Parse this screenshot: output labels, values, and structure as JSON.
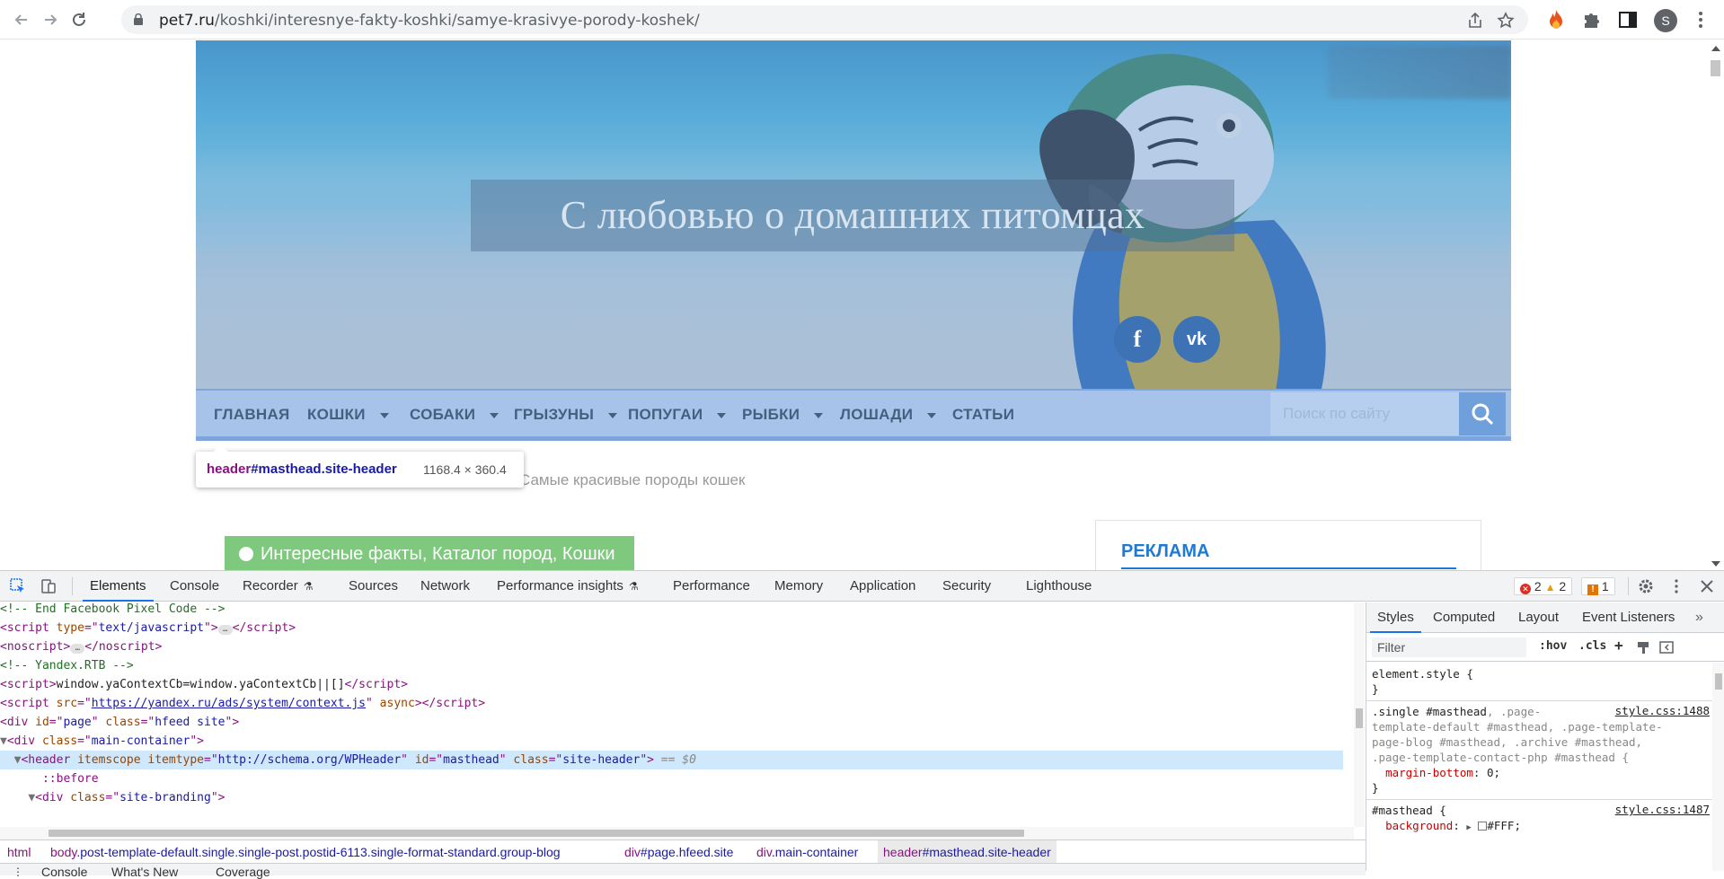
{
  "browser": {
    "url_host": "pet7.ru",
    "url_path": "/koshki/interesnye-fakty-koshki/samye-krasivye-porody-koshek/",
    "profile_initial": "S"
  },
  "site": {
    "title": "С любовью о домашних питомцах",
    "social": [
      "f",
      "vk"
    ],
    "nav": [
      {
        "label": "ГЛАВНАЯ",
        "has_dropdown": false
      },
      {
        "label": "КОШКИ",
        "has_dropdown": true
      },
      {
        "label": "СОБАКИ",
        "has_dropdown": true
      },
      {
        "label": "ГРЫЗУНЫ",
        "has_dropdown": true
      },
      {
        "label": "ПОПУГАИ",
        "has_dropdown": true
      },
      {
        "label": "РЫБКИ",
        "has_dropdown": true
      },
      {
        "label": "ЛОШАДИ",
        "has_dropdown": true
      },
      {
        "label": "СТАТЬИ",
        "has_dropdown": false
      }
    ],
    "search_placeholder": "Поиск по сайту",
    "breadcrumb_current": "Самые красивые породы кошек",
    "category_bar": "Интересные факты, Каталог пород, Кошки",
    "ad_title": "РЕКЛАМА"
  },
  "inspect_tooltip": {
    "tag": "header",
    "selector": "#masthead.site-header",
    "dimensions": "1168.4 × 360.4"
  },
  "devtools": {
    "tabs": [
      "Elements",
      "Console",
      "Recorder",
      "Sources",
      "Network",
      "Performance insights",
      "Performance",
      "Memory",
      "Application",
      "Security",
      "Lighthouse"
    ],
    "active_tab": "Elements",
    "errors": "2",
    "warnings": "2",
    "issues": "1",
    "dom_lines": {
      "l1": "<!-- End Facebook Pixel Code -->",
      "l2_tag": "script",
      "l2_attr": "type",
      "l2_val": "text/javascript",
      "l3_tag": "noscript",
      "l4": "<!-- Yandex.RTB -->",
      "l5_text": "window.yaContextCb=window.yaContextCb||[]",
      "l6_attr": "src",
      "l6_link": "https://yandex.ru/ads/system/context.js",
      "l6_async": "async",
      "l7_id": "page",
      "l7_class": "hfeed site",
      "l8_class": "main-container",
      "l9_itemscope": "itemscope",
      "l9_itemtype": "http://schema.org/WPHeader",
      "l9_id": "masthead",
      "l9_class": "site-header",
      "l9_dollar": "== $0",
      "l10": "::before",
      "l11_class": "site-branding"
    },
    "breadcrumbs": [
      {
        "tag": "html",
        "rest": ""
      },
      {
        "tag": "body",
        "rest": ".post-template-default.single.single-post.postid-6113.single-format-standard.group-blog"
      },
      {
        "tag": "div",
        "rest": "#page.hfeed.site"
      },
      {
        "tag": "div",
        "rest": ".main-container"
      },
      {
        "tag": "header",
        "rest": "#masthead.site-header"
      }
    ],
    "styles_tabs": [
      "Styles",
      "Computed",
      "Layout",
      "Event Listeners"
    ],
    "filter_placeholder": "Filter",
    "hov": ":hov",
    "cls": ".cls",
    "rules": {
      "r1_selector": "element.style {",
      "r1_close": "}",
      "r2_src": "style.css:1488",
      "r2_l1a": ".single #masthead",
      "r2_l1b": ", .page-",
      "r2_l2": "template-default #masthead, .page-template-",
      "r2_l3": "page-blog #masthead, .archive #masthead,",
      "r2_l4": ".page-template-contact-php #masthead {",
      "r2_prop": "margin-bottom",
      "r2_val": "0;",
      "r2_close": "}",
      "r3_selector": "#masthead {",
      "r3_src": "style.css:1487",
      "r3_prop": "background",
      "r3_val": "#FFF;"
    },
    "drawer_tabs": [
      "Console",
      "What's New",
      "Coverage"
    ]
  }
}
